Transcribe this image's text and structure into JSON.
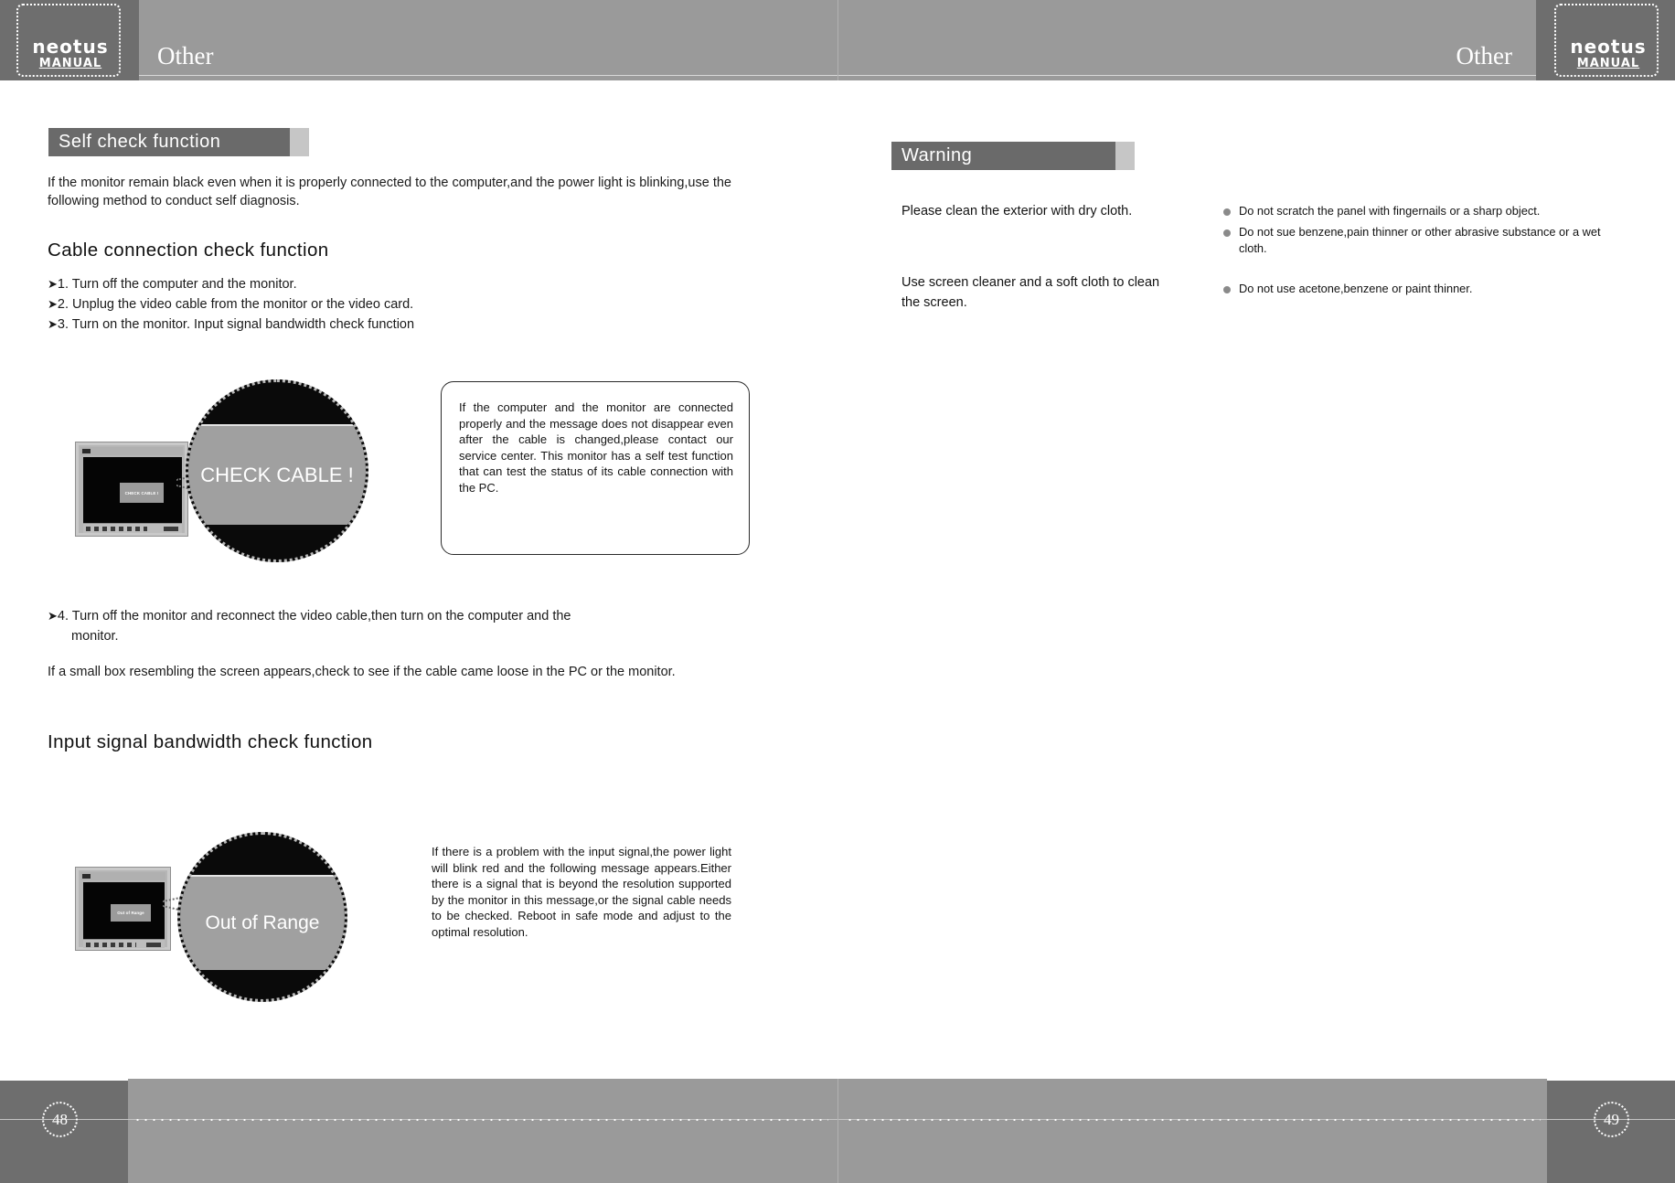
{
  "document": {
    "brand_logo_word": "neotus",
    "brand_logo_sub": "MANUAL",
    "header_title_left": "Other",
    "header_title_right": "Other",
    "page_number_left": "48",
    "page_number_right": "49",
    "colors": {
      "header_band": "#9a9a9a",
      "header_dark": "#6e6e6e",
      "section_bar": "#6a6a6a",
      "section_bar_tail": "#c6c6c6",
      "footer_dark": "#6e6e6e",
      "footer_mid": "#9a9a9a",
      "screen_black": "#050505",
      "zoom_band_gray": "#a0a0a0",
      "bullet_gray": "#8a8a8a",
      "text": "#121212"
    }
  },
  "left_page": {
    "section_title": "Self check function",
    "intro": "If the monitor remain black even when it is properly connected to the computer,and the power light is blinking,use the following method to conduct self diagnosis.",
    "subsection_1": {
      "heading": "Cable connection check function",
      "steps": [
        "1. Turn off the computer and the monitor.",
        "2. Unplug the video cable from the monitor or the video card.",
        "3. Turn on the monitor. Input signal bandwidth check function"
      ],
      "step_arrow": "➤",
      "figure": {
        "zoom_message": "CHECK CABLE !",
        "mini_screen_message": "CHECK CABLE !"
      },
      "note_box": "If the computer and the monitor are connected properly and the message does not disappear even after the cable is changed,please contact our service center. This monitor has a self test function that can test the status of its cable connection with the PC.",
      "step_4": "4. Turn off the monitor and reconnect the video cable,then turn on the computer and the",
      "step_4_cont": "monitor.",
      "closing": "If a small box resembling the screen appears,check to see if the cable came loose in the PC or the monitor."
    },
    "subsection_2": {
      "heading": "Input signal bandwidth check function",
      "figure": {
        "zoom_message": "Out of Range",
        "mini_screen_message": "Out of Range"
      },
      "note_text": "If there is a problem with the input signal,the power light will blink red and the following message appears.Either there is a signal that is beyond the resolution supported by the monitor in this message,or the signal cable needs to be checked. Reboot in safe mode and adjust to the optimal resolution."
    }
  },
  "right_page": {
    "section_title": "Warning",
    "care_items": [
      "Please clean the exterior with dry cloth.",
      "Use screen cleaner and a soft cloth to clean the screen."
    ],
    "cautions": [
      "Do not scratch the panel with fingernails or a sharp object.",
      "Do not sue benzene,pain thinner or other abrasive substance or a wet cloth.",
      "Do not use acetone,benzene or paint thinner."
    ]
  }
}
